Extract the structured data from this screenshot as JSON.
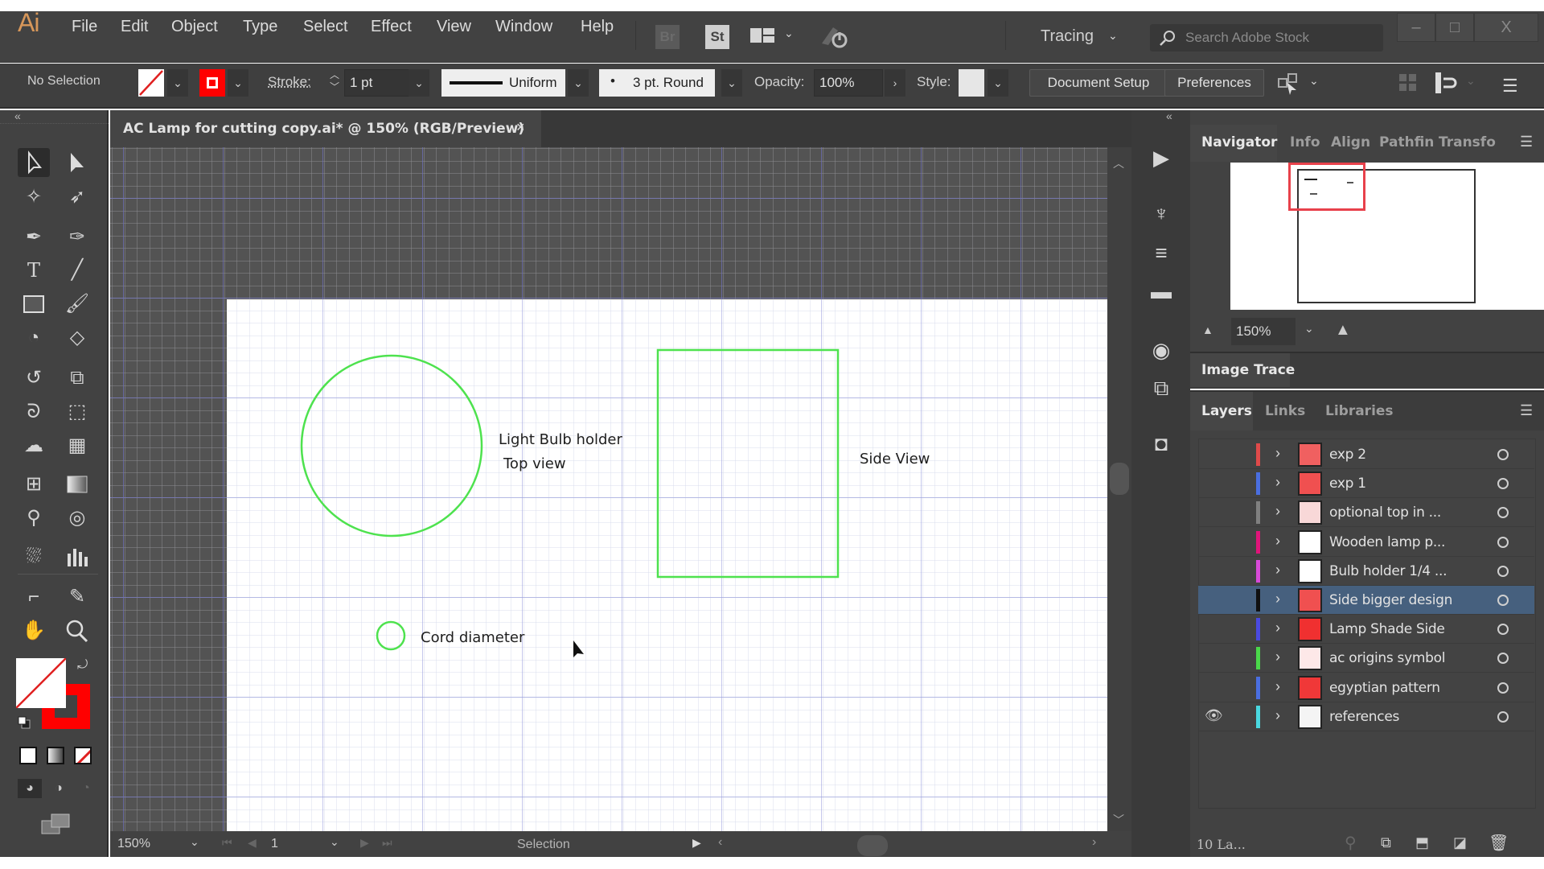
{
  "app": {
    "logo": "Ai",
    "menu": [
      "File",
      "Edit",
      "Object",
      "Type",
      "Select",
      "Effect",
      "View",
      "Window",
      "Help"
    ],
    "bridge_label": "Br",
    "stock_label": "St",
    "workspace": "Tracing",
    "search_placeholder": "Search Adobe Stock",
    "window_controls": {
      "minimize": "–",
      "maximize": "□",
      "close": "X"
    }
  },
  "control_bar": {
    "selection_status": "No Selection",
    "stroke_label": "Stroke:",
    "stroke_weight": "1 pt",
    "profile": "Uniform",
    "brush": "3 pt. Round",
    "opacity_label": "Opacity:",
    "opacity": "100%",
    "style_label": "Style:",
    "document_setup": "Document Setup",
    "preferences": "Preferences",
    "fill_color": "none",
    "stroke_color": "#ff0000"
  },
  "document": {
    "tab_title": "AC Lamp for cutting copy.ai* @ 150% (RGB/Preview)",
    "close": "×",
    "artboard_labels": {
      "bulb_holder_line1": "Light Bulb holder",
      "bulb_holder_line2": "Top view",
      "side_view": "Side View",
      "cord_diameter": "Cord diameter"
    },
    "shape_stroke_color": "#4ee24e"
  },
  "status_bar": {
    "zoom": "150%",
    "artboard_number": "1",
    "current_tool": "Selection"
  },
  "tools": [
    "selection-tool",
    "direct-selection-tool",
    "magic-wand-tool",
    "lasso-tool",
    "pen-tool",
    "curvature-tool",
    "type-tool",
    "line-segment-tool",
    "rectangle-tool",
    "paintbrush-tool",
    "shaper-tool",
    "eraser-tool",
    "rotate-tool",
    "scale-tool",
    "warp-tool",
    "free-transform-tool",
    "shape-builder-tool",
    "perspective-grid-tool",
    "mesh-tool",
    "gradient-tool",
    "eyedropper-tool",
    "blend-tool",
    "symbol-sprayer-tool",
    "column-graph-tool",
    "artboard-tool",
    "slice-tool",
    "hand-tool",
    "zoom-tool"
  ],
  "navigator": {
    "tabs": [
      "Navigator",
      "Info",
      "Align",
      "Pathfin",
      "Transfo"
    ],
    "zoom": "150%"
  },
  "image_trace": {
    "title": "Image Trace"
  },
  "layers_panel": {
    "tabs": [
      "Layers",
      "Links",
      "Libraries"
    ],
    "count_label": "10 La...",
    "layers": [
      {
        "name": "exp 2",
        "color": "#e04a4a",
        "visible": false,
        "selected": false
      },
      {
        "name": "exp 1",
        "color": "#4a6ee0",
        "visible": false,
        "selected": false
      },
      {
        "name": "optional top in ...",
        "color": "#808080",
        "visible": false,
        "selected": false
      },
      {
        "name": "Wooden lamp p...",
        "color": "#e0147a",
        "visible": false,
        "selected": false
      },
      {
        "name": "Bulb holder 1/4 ...",
        "color": "#d84ad8",
        "visible": false,
        "selected": false
      },
      {
        "name": "Side bigger design",
        "color": "#111111",
        "visible": false,
        "selected": true
      },
      {
        "name": "Lamp Shade Side",
        "color": "#4a4ae0",
        "visible": false,
        "selected": false
      },
      {
        "name": "ac origins symbol",
        "color": "#4ad84a",
        "visible": false,
        "selected": false
      },
      {
        "name": "egyptian pattern",
        "color": "#4a6ee0",
        "visible": false,
        "selected": false
      },
      {
        "name": "references",
        "color": "#4ad8e0",
        "visible": true,
        "selected": false
      }
    ]
  }
}
